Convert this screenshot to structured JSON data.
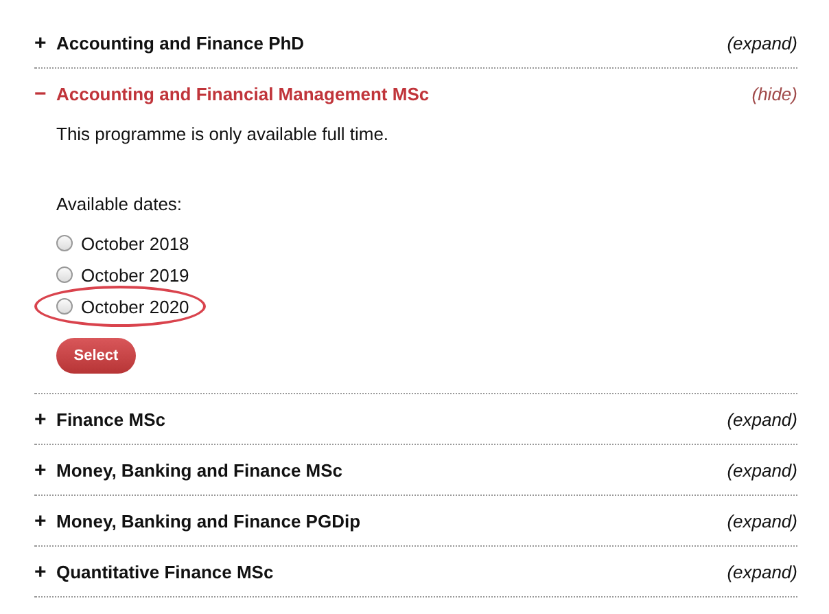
{
  "programmes": [
    {
      "toggle": "+",
      "title": "Accounting and Finance PhD",
      "action": "(expand)",
      "expanded": false
    },
    {
      "toggle": "−",
      "title": "Accounting and Financial Management MSc",
      "action": "(hide)",
      "expanded": true,
      "note": "This programme is only available full time.",
      "dates_label": "Available dates:",
      "dates": [
        {
          "label": "October 2018",
          "selected": false,
          "highlighted": false
        },
        {
          "label": "October 2019",
          "selected": false,
          "highlighted": false
        },
        {
          "label": "October 2020",
          "selected": false,
          "highlighted": true
        }
      ],
      "button": "Select"
    },
    {
      "toggle": "+",
      "title": "Finance MSc",
      "action": "(expand)",
      "expanded": false
    },
    {
      "toggle": "+",
      "title": "Money, Banking and Finance MSc",
      "action": "(expand)",
      "expanded": false
    },
    {
      "toggle": "+",
      "title": "Money, Banking and Finance PGDip",
      "action": "(expand)",
      "expanded": false
    },
    {
      "toggle": "+",
      "title": "Quantitative Finance MSc",
      "action": "(expand)",
      "expanded": false
    }
  ]
}
